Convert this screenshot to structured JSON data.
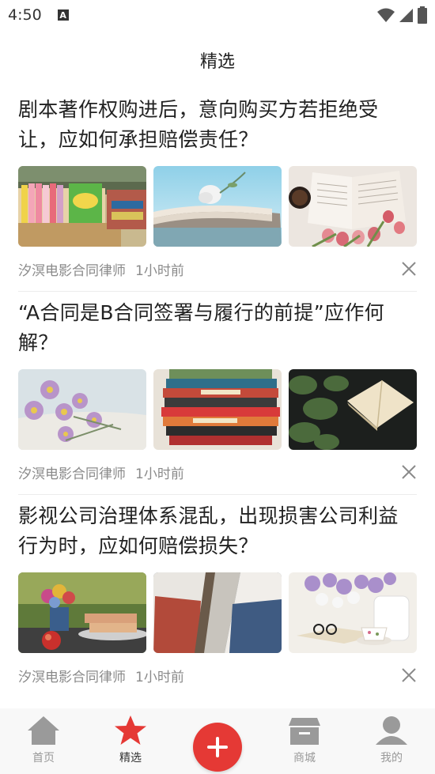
{
  "status_bar": {
    "time": "4:50",
    "notification_icon": "A"
  },
  "header": {
    "title": "精选"
  },
  "articles": [
    {
      "title": "剧本著作权购进后，意向购买方若拒绝受让，应如何承担赔偿责任？",
      "author": "汐溟电影合同律师",
      "time": "1小时前"
    },
    {
      "title": "“A合同是B合同签署与履行的前提”应作何解？",
      "author": "汐溟电影合同律师",
      "time": "1小时前"
    },
    {
      "title": "影视公司治理体系混乱，出现损害公司利益行为时，应如何赔偿损失？",
      "author": "汐溟电影合同律师",
      "time": "1小时前"
    }
  ],
  "tabs": {
    "home": "首页",
    "featured": "精选",
    "mall": "商城",
    "mine": "我的"
  },
  "colors": {
    "accent": "#e53935",
    "icon_gray": "#999999"
  }
}
